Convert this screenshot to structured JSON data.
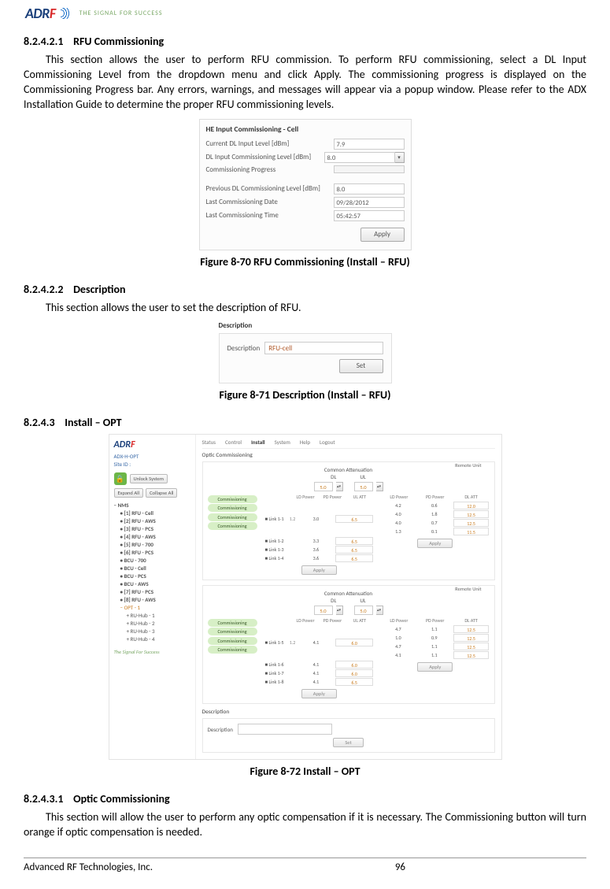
{
  "header": {
    "brand": "ADRF",
    "tagline": "THE SIGNAL FOR SUCCESS"
  },
  "sections": {
    "s1": {
      "num": "8.2.4.2.1",
      "title": "RFU Commissioning"
    },
    "s2": {
      "num": "8.2.4.2.2",
      "title": "Description"
    },
    "s3": {
      "num": "8.2.4.3",
      "title": "Install – OPT"
    },
    "s4": {
      "num": "8.2.4.3.1",
      "title": "Optic Commissioning"
    }
  },
  "paragraphs": {
    "p1": "This section allows the user to perform RFU commission. To perform RFU commissioning, select a DL Input Commissioning Level from the dropdown menu and click Apply. The commissioning progress is displayed on the Commissioning Progress bar.  Any errors, warnings, and messages will appear via a popup window.  Please refer to the ADX Installation Guide to determine the proper RFU commissioning levels.",
    "p2": "This section allows the user to set the description of RFU.",
    "p3": "This section will allow the user to perform any optic compensation if it is necessary.  The Commissioning button will turn orange if optic compensation is needed."
  },
  "captions": {
    "c1": "Figure 8-70    RFU Commissioning (Install – RFU)",
    "c2": "Figure 8-71    Description (Install – RFU)",
    "c3": "Figure 8-72    Install – OPT"
  },
  "fig70": {
    "title": "HE Input Commissioning - Cell",
    "r1": {
      "lbl": "Current DL Input Level [dBm]",
      "val": "7.9"
    },
    "r2": {
      "lbl": "DL Input Commissioning Level [dBm]",
      "val": "8.0"
    },
    "r3": {
      "lbl": "Commissioning Progress"
    },
    "r4": {
      "lbl": "Previous DL Commissioning Level [dBm]",
      "val": "8.0"
    },
    "r5": {
      "lbl": "Last Commissioning Date",
      "val": "09/28/2012"
    },
    "r6": {
      "lbl": "Last Commissioning Time",
      "val": "05:42:57"
    },
    "apply": "Apply"
  },
  "fig71": {
    "title": "Description",
    "lbl": "Description",
    "val": "RFU-cell",
    "set": "Set"
  },
  "fig72": {
    "brand": "ADRF",
    "model": "ADX-H-OPT",
    "site": "Site ID :",
    "unlock": "Unlock System",
    "expand": "Expand All",
    "collapse": "Collapse All",
    "tree": {
      "root": "NMS",
      "items": [
        "[1] RFU - Cell",
        "[2] RFU - AWS",
        "[3] RFU - PCS",
        "[4] RFU - AWS",
        "[5] RFU - 700",
        "[6] RFU - PCS",
        "BCU - 700",
        "BCU - Cell",
        "BCU - PCS",
        "BCU - AWS",
        "[7] RFU - PCS",
        "[8] RFU - AWS"
      ],
      "opt": "OPT - 1",
      "hubs": [
        "RU-Hub - 1",
        "RU-Hub - 2",
        "RU-Hub - 3",
        "RU-Hub - 4"
      ]
    },
    "tagline": "The Signal For Success",
    "tabs": [
      "Status",
      "Control",
      "Install",
      "System",
      "Help",
      "Logout"
    ],
    "activeTab": "Install",
    "grpTitle": "Optic Commissioning",
    "commonAtt": "Common Attenuation",
    "dl": "DL",
    "ul": "UL",
    "val5": "5.0",
    "remote": "Remote Unit",
    "hdrL": [
      "LD Power",
      "PD Power",
      "UL ATT"
    ],
    "hdrR": [
      "LD Power",
      "PD Power",
      "DL ATT"
    ],
    "commis": "Commissioning",
    "apply": "Apply",
    "block1": {
      "ldGroup": "1.2",
      "rows": [
        {
          "link": "Link 1-1",
          "pd": "3.0",
          "ul": "6.5",
          "ld2": "4.2",
          "pd2": "0.6",
          "dl": "12.0"
        },
        {
          "link": "Link 1-2",
          "pd": "3.3",
          "ul": "6.5",
          "ld2": "4.0",
          "pd2": "1.8",
          "dl": "12.5"
        },
        {
          "link": "Link 1-3",
          "pd": "3.6",
          "ul": "6.5",
          "ld2": "4.0",
          "pd2": "0.7",
          "dl": "12.5"
        },
        {
          "link": "Link 1-4",
          "pd": "3.6",
          "ul": "6.5",
          "ld2": "1.3",
          "pd2": "0.1",
          "dl": "11.5"
        }
      ]
    },
    "block2": {
      "ldGroup": "1.2",
      "rows": [
        {
          "link": "Link 1-5",
          "pd": "4.1",
          "ul": "6.0",
          "ld2": "4.7",
          "pd2": "1.1",
          "dl": "12.5"
        },
        {
          "link": "Link 1-6",
          "pd": "4.1",
          "ul": "6.0",
          "ld2": "1.0",
          "pd2": "0.9",
          "dl": "12.5"
        },
        {
          "link": "Link 1-7",
          "pd": "4.1",
          "ul": "6.0",
          "ld2": "4.7",
          "pd2": "1.1",
          "dl": "12.5"
        },
        {
          "link": "Link 1-8",
          "pd": "4.1",
          "ul": "6.5",
          "ld2": "4.1",
          "pd2": "1.1",
          "dl": "12.5"
        }
      ]
    },
    "desc": {
      "title": "Description",
      "lbl": "Description",
      "set": "Set"
    }
  },
  "footer": {
    "company": "Advanced RF Technologies, Inc.",
    "page": "96"
  }
}
